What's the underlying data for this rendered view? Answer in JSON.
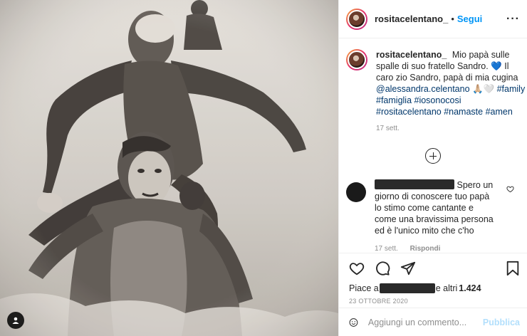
{
  "post": {
    "username": "rositacelentano_",
    "follow_label": "Segui",
    "more_label": "···"
  },
  "caption": {
    "username": "rositacelentano_",
    "text_1": "Mio papà sulle spalle di suo fratello Sandro. ",
    "heart": "💙",
    "text_2": " Il caro zio Sandro, papà di mia cugina ",
    "mention": "@alessandra.celentano",
    "emojis": " 🙏🏼🤍 ",
    "hashtags": "#family #famiglia #iosonocosi #rositacelentano #namaste #amen",
    "time": "17 sett."
  },
  "comment": {
    "text": "Spero un giorno di conoscere tuo papà lo stimo come cantante e come una bravissima persona ed è l'unico mito che c'ho",
    "time": "17 sett.",
    "reply_label": "Rispondi"
  },
  "likes": {
    "prefix": "Piace a",
    "suffix": "e altri",
    "count": "1.424"
  },
  "date": "23 OTTOBRE 2020",
  "add_comment": {
    "placeholder": "Aggiungi un commento...",
    "publish_label": "Pubblica"
  },
  "colors": {
    "accent": "#0095f6",
    "link": "#00376b",
    "muted": "#8e8e8e"
  }
}
